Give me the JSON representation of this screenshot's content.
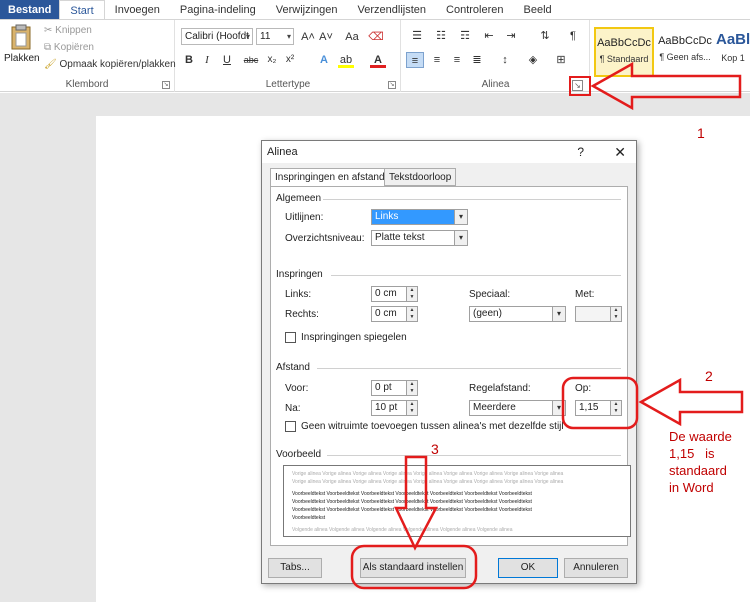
{
  "ribbon_tabs": [
    "Bestand",
    "Start",
    "Invoegen",
    "Pagina-indeling",
    "Verwijzingen",
    "Verzendlijsten",
    "Controleren",
    "Beeld"
  ],
  "clipboard": {
    "paste_label": "Plakken",
    "cut_label": "Knippen",
    "copy_label": "Kopiëren",
    "format_painter_label": "Opmaak kopiëren/plakken",
    "group_label": "Klembord"
  },
  "font": {
    "font_name": "Calibri (Hoofdt",
    "font_size": "11",
    "group_label": "Lettertype",
    "grow_label": "A˄",
    "shrink_label": "A˅",
    "case_label": "Aa",
    "bold": "B",
    "italic": "I",
    "underline": "U",
    "strike": "abc",
    "subscript": "x₂",
    "superscript": "x²"
  },
  "paragraph": {
    "group_label": "Alinea"
  },
  "styles": {
    "items": [
      {
        "sample": "AaBbCcDc",
        "name": "¶ Standaard"
      },
      {
        "sample": "AaBbCcDc",
        "name": "¶ Geen afs..."
      },
      {
        "sample": "AaBl",
        "name": "Kop 1"
      }
    ]
  },
  "dialog": {
    "title": "Alinea",
    "help": "?",
    "close": "✕",
    "tab_indents": "Inspringingen en afstand",
    "tab_flow": "Tekstdoorloop",
    "general": {
      "section": "Algemeen",
      "alignment_label": "Uitlijnen:",
      "alignment_value": "Links",
      "outline_label": "Overzichtsniveau:",
      "outline_value": "Platte tekst"
    },
    "indent": {
      "section": "Inspringen",
      "left_label": "Links:",
      "left_value": "0 cm",
      "right_label": "Rechts:",
      "right_value": "0 cm",
      "special_label": "Speciaal:",
      "special_value": "(geen)",
      "by_label": "Met:",
      "by_value": "",
      "mirror_label": "Inspringingen spiegelen"
    },
    "spacing": {
      "section": "Afstand",
      "before_label": "Voor:",
      "before_value": "0 pt",
      "after_label": "Na:",
      "after_value": "10 pt",
      "line_label": "Regelafstand:",
      "line_value": "Meerdere",
      "at_label": "Op:",
      "at_value": "1,15",
      "no_space_label": "Geen witruimte toevoegen tussen alinea's met dezelfde stijl"
    },
    "preview": {
      "section": "Voorbeeld",
      "prev_line": "Vorige alinea Vorige alinea Vorige alinea Vorige alinea Vorige alinea Vorige alinea Vorige alinea Vorige alinea Vorige alinea",
      "sample_line": "Voorbeeldtekst Voorbeeldtekst Voorbeeldtekst Voorbeeldtekst Voorbeeldtekst Voorbeeldtekst Voorbeeldtekst",
      "sample_last": "Voorbeeldtekst",
      "next_line": "Volgende alinea Volgende alinea Volgende alinea Volgende alinea Volgende alinea Volgende alinea"
    },
    "buttons": {
      "tabs": "Tabs...",
      "default": "Als standaard instellen",
      "ok": "OK",
      "cancel": "Annuleren"
    }
  },
  "annotations": {
    "n1": "1",
    "n2": "2",
    "n3": "3",
    "note_line1": "De waarde",
    "note_line2": "1,15   is",
    "note_line3": "standaard",
    "note_line4": "in Word"
  },
  "colors": {
    "accent": "#2b579a",
    "annotation": "#c00000",
    "selection": "#3399ff"
  }
}
